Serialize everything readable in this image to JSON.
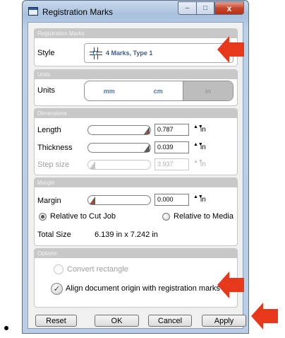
{
  "window": {
    "title": "Registration Marks",
    "minimize_glyph": "–",
    "maximize_glyph": "□",
    "close_glyph": "x"
  },
  "sections": {
    "marks": "Registration Marks",
    "units": "Units",
    "dimensions": "Dimensions",
    "margin": "Margin",
    "options": "Options"
  },
  "style": {
    "label": "Style",
    "value": "4 Marks, Type 1",
    "icon": "registration-marks-icon"
  },
  "units": {
    "label": "Units",
    "options": [
      "mm",
      "cm",
      "in"
    ],
    "selected": "in"
  },
  "dimensions": {
    "length": {
      "label": "Length",
      "value": "0.787",
      "unit": "in"
    },
    "thickness": {
      "label": "Thickness",
      "value": "0.039",
      "unit": "in"
    },
    "step_size": {
      "label": "Step size",
      "value": "3.937",
      "unit": "in"
    }
  },
  "margin": {
    "label": "Margin",
    "value": "0.000",
    "unit": "in",
    "relative_cut_job": "Relative to Cut Job",
    "relative_media": "Relative to Media",
    "total_size_label": "Total Size",
    "total_size_value": "6.139 in x 7.242 in"
  },
  "options": {
    "convert_rectangle": "Convert rectangle",
    "align_origin": "Align document origin with registration marks"
  },
  "buttons": {
    "reset": "Reset",
    "ok": "OK",
    "cancel": "Cancel",
    "apply": "Apply"
  },
  "spin_glyph": "▲▼",
  "check_glyph": "✓",
  "colors": {
    "annotation_arrow": "#e8381c",
    "accent_text": "#3d5f8c"
  }
}
